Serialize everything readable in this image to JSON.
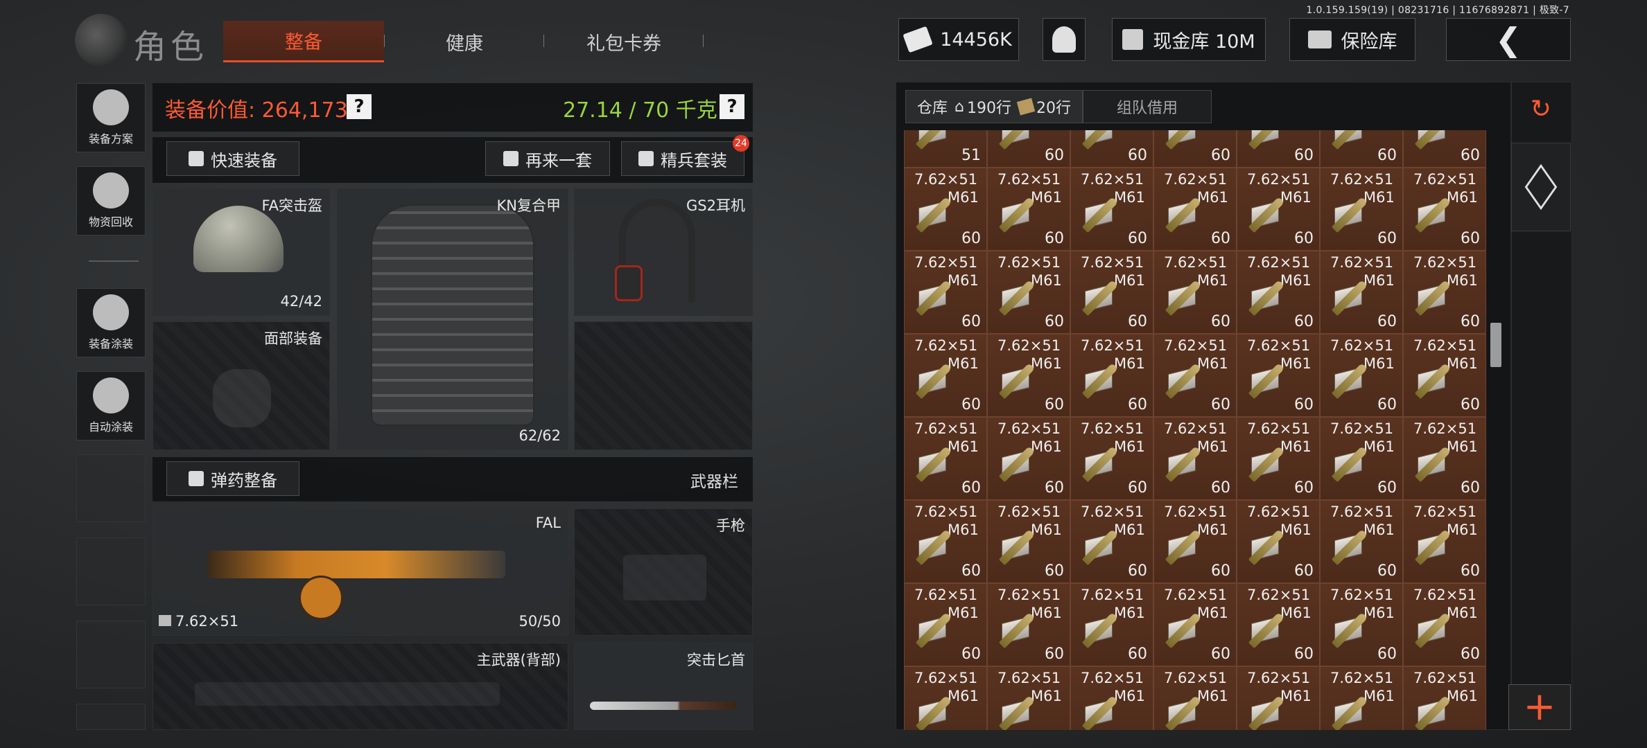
{
  "version_text": "1.0.159.159(19) | 08231716 | 11676892871 | 极致-7",
  "header": {
    "title": "角色",
    "tabs": [
      {
        "label": "整备",
        "active": true
      },
      {
        "label": "健康",
        "active": false
      },
      {
        "label": "礼包卡券",
        "active": false
      }
    ],
    "currency": "14456K",
    "cash_vault": "现金库 10M",
    "safe_box": "保险库"
  },
  "sidebar": {
    "items": [
      {
        "label": "装备方案",
        "icon": "loadout-icon"
      },
      {
        "label": "物资回收",
        "icon": "recycle-icon"
      },
      {
        "label": "装备涂装",
        "icon": "paint-helmet-icon"
      },
      {
        "label": "自动涂装",
        "icon": "auto-paint-icon"
      }
    ]
  },
  "equipment": {
    "value_label": "装备价值: 264,173",
    "weight_label": "27.14 / 70 千克",
    "quick_equip": "快速装备",
    "repeat_set": "再来一套",
    "elite_set": "精兵套装",
    "elite_badge": "24",
    "slots": {
      "helmet": {
        "name": "FA突击盔",
        "durability": "42/42"
      },
      "face": {
        "name": "面部装备"
      },
      "armor": {
        "name": "KN复合甲",
        "durability": "62/62"
      },
      "headset": {
        "name": "GS2耳机"
      }
    },
    "ammo_button": "弹药整备",
    "weapon_bar": "武器栏",
    "primary": {
      "name": "FAL",
      "caliber": "7.62×51",
      "ammo": "50/50"
    },
    "pistol": {
      "name": "手枪"
    },
    "back_weapon": {
      "name": "主武器(背部)"
    },
    "knife": {
      "name": "突击匕首"
    }
  },
  "warehouse": {
    "tab_label": "仓库",
    "home_rows": "190行",
    "ticket_rows": "20行",
    "team_borrow": "组队借用",
    "item_caliber": "7.62×51",
    "item_name": "M61",
    "first_row_counts": [
      "51",
      "60",
      "60",
      "60",
      "60",
      "60",
      "60"
    ],
    "row_counts": [
      "60",
      "60",
      "60",
      "60",
      "60",
      "60",
      "60"
    ],
    "rows_visible": 8
  },
  "colors": {
    "accent_orange": "#ff5a32",
    "weight_green": "#9ad43a",
    "cell_brown": "#4c2a1a"
  }
}
